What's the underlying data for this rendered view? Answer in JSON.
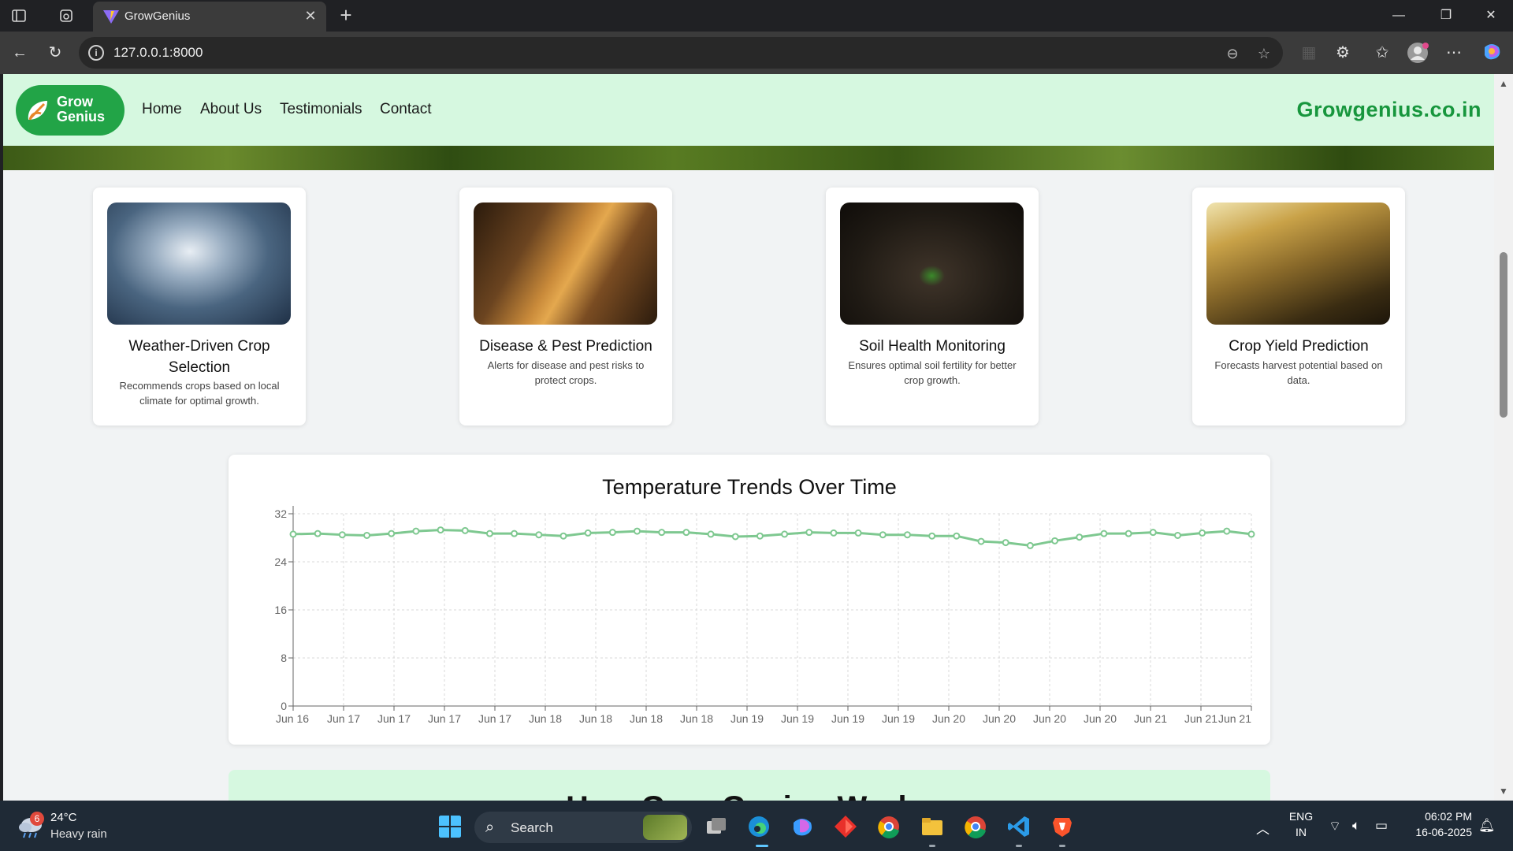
{
  "browser": {
    "tab_title": "GrowGenius",
    "url": "127.0.0.1:8000"
  },
  "navbar": {
    "logo_line1": "Grow",
    "logo_line2": "Genius",
    "links": [
      "Home",
      "About Us",
      "Testimonials",
      "Contact"
    ],
    "site": "Growgenius.co.in"
  },
  "features": [
    {
      "title": "Weather-Driven Crop Selection",
      "desc": "Recommends crops based on local climate for optimal growth."
    },
    {
      "title": "Disease & Pest Prediction",
      "desc": "Alerts for disease and pest risks to protect crops."
    },
    {
      "title": "Soil Health Monitoring",
      "desc": "Ensures optimal soil fertility for better crop growth."
    },
    {
      "title": "Crop Yield Prediction",
      "desc": "Forecasts harvest potential based on data."
    }
  ],
  "chart_data": {
    "type": "line",
    "title": "Temperature Trends Over Time",
    "categories": [
      "Jun 16",
      "Jun 16",
      "Jun 16",
      "Jun 16",
      "Jun 17",
      "Jun 17",
      "Jun 17",
      "Jun 17",
      "Jun 17",
      "Jun 17",
      "Jun 17",
      "Jun 18",
      "Jun 18",
      "Jun 18",
      "Jun 18",
      "Jun 18",
      "Jun 18",
      "Jun 18",
      "Jun 19",
      "Jun 19",
      "Jun 19",
      "Jun 19",
      "Jun 19",
      "Jun 19",
      "Jun 19",
      "Jun 20",
      "Jun 20",
      "Jun 20",
      "Jun 20",
      "Jun 20",
      "Jun 20",
      "Jun 20",
      "Jun 21",
      "Jun 21",
      "Jun 21",
      "Jun 21",
      "Jun 21",
      "Jun 21",
      "Jun 21",
      "Jun 21"
    ],
    "series": [
      {
        "values": [
          28.6,
          28.7,
          28.5,
          28.4,
          28.7,
          29.1,
          29.3,
          29.2,
          28.7,
          28.7,
          28.5,
          28.3,
          28.8,
          28.9,
          29.1,
          28.9,
          28.9,
          28.6,
          28.2,
          28.3,
          28.6,
          28.9,
          28.8,
          28.8,
          28.5,
          28.5,
          28.3,
          28.3,
          27.4,
          27.2,
          26.7,
          27.5,
          28.1,
          28.7,
          28.7,
          28.9,
          28.4,
          28.8,
          29.1,
          28.6
        ]
      }
    ],
    "x_tick_labels": [
      "Jun 16",
      "Jun 17",
      "Jun 17",
      "Jun 17",
      "Jun 17",
      "Jun 18",
      "Jun 18",
      "Jun 18",
      "Jun 18",
      "Jun 19",
      "Jun 19",
      "Jun 19",
      "Jun 19",
      "Jun 20",
      "Jun 20",
      "Jun 20",
      "Jun 20",
      "Jun 21",
      "Jun 21",
      "Jun 21"
    ],
    "y_ticks": [
      0,
      8,
      16,
      24,
      32
    ],
    "ylim": [
      0,
      32
    ],
    "grid": true,
    "color": "#7ec890"
  },
  "next_section": {
    "title": "How GrowGenius Works"
  },
  "taskbar": {
    "weather_temp": "24°C",
    "weather_desc": "Heavy rain",
    "weather_badge": "6",
    "search": "Search",
    "lang1": "ENG",
    "lang2": "IN",
    "time": "06:02 PM",
    "date": "16-06-2025"
  }
}
